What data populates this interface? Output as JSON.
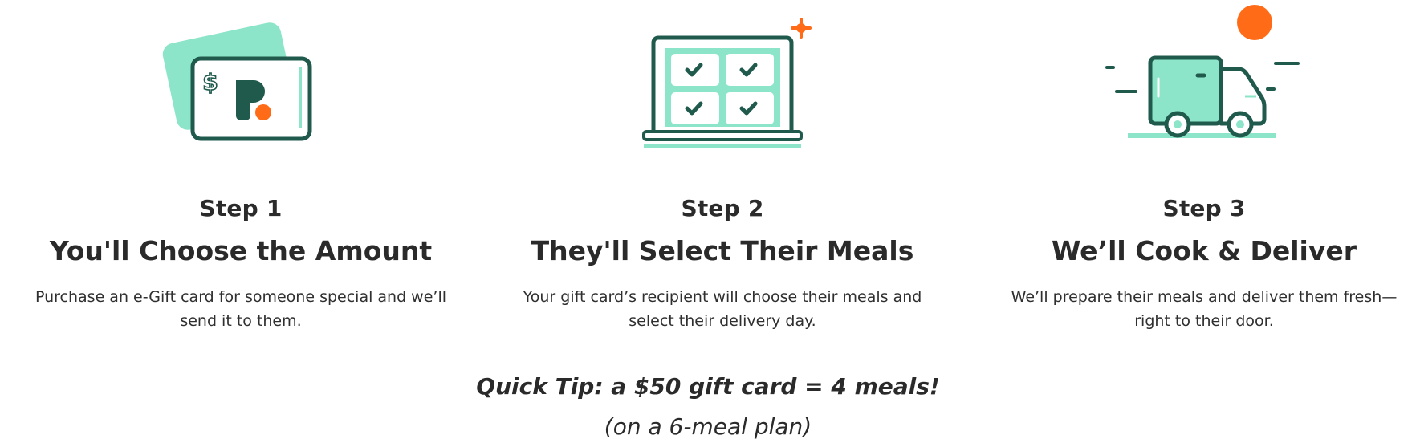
{
  "colors": {
    "dark_green": "#1f5a4c",
    "mint": "#8de5c9",
    "orange": "#ff6b16",
    "text": "#2b2b2b"
  },
  "steps": [
    {
      "label": "Step 1",
      "title": "You'll Choose the Amount",
      "description": "Purchase an e-Gift card for someone special and we’ll send it to them.",
      "icon": "gift-card-icon"
    },
    {
      "label": "Step 2",
      "title": "They'll Select Their Meals",
      "description": "Your gift card’s recipient will choose their meals and select their delivery day.",
      "icon": "laptop-meal-selection-icon"
    },
    {
      "label": "Step 3",
      "title": "We’ll Cook & Deliver",
      "description": "We’ll prepare their meals and deliver them fresh—right to their door.",
      "icon": "delivery-truck-icon"
    }
  ],
  "tip": {
    "text": "Quick Tip: a $50 gift card = 4 meals!",
    "subtext": "(on a 6-meal plan)"
  }
}
